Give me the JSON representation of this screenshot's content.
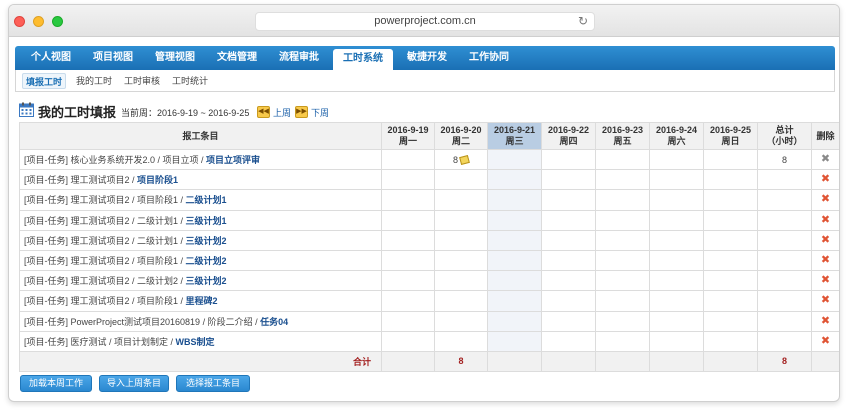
{
  "browser": {
    "url": "powerproject.com.cn"
  },
  "nav": {
    "items": [
      {
        "label": "个人视图"
      },
      {
        "label": "项目视图"
      },
      {
        "label": "管理视图"
      },
      {
        "label": "文档管理"
      },
      {
        "label": "流程审批"
      },
      {
        "label": "工时系统"
      },
      {
        "label": "敏捷开发"
      },
      {
        "label": "工作协同"
      }
    ],
    "active_index": 5
  },
  "subnav": {
    "items": [
      {
        "label": "填报工时"
      },
      {
        "label": "我的工时"
      },
      {
        "label": "工时审核"
      },
      {
        "label": "工时统计"
      }
    ],
    "active_index": 0
  },
  "page": {
    "title": "我的工时填报",
    "week_label": "当前周：2016-9-19 ~ 2016-9-25",
    "prev_label": "上周",
    "next_label": "下周",
    "prev_icon": "double-left-arrow-icon",
    "next_icon": "double-right-arrow-icon"
  },
  "table": {
    "item_header": "报工条目",
    "days": [
      {
        "date": "2016-9-19",
        "weekday": "周一"
      },
      {
        "date": "2016-9-20",
        "weekday": "周二"
      },
      {
        "date": "2016-9-21",
        "weekday": "周三"
      },
      {
        "date": "2016-9-22",
        "weekday": "周四"
      },
      {
        "date": "2016-9-23",
        "weekday": "周五"
      },
      {
        "date": "2016-9-24",
        "weekday": "周六"
      },
      {
        "date": "2016-9-25",
        "weekday": "周日"
      }
    ],
    "today_index": 2,
    "total_header_1": "总计",
    "total_header_2": "（小时）",
    "delete_header": "删除",
    "rows": [
      {
        "prefix": "[项目-任务] 核心业务系统开发2.0 / 项目立项 / ",
        "link": "项目立项评审",
        "hours": [
          "",
          "8",
          "",
          "",
          "",
          "",
          ""
        ],
        "total": "8",
        "deletable": false
      },
      {
        "prefix": "[项目-任务] 理工测试项目2 / ",
        "link": "项目阶段1",
        "hours": [
          "",
          "",
          "",
          "",
          "",
          "",
          ""
        ],
        "total": "",
        "deletable": true
      },
      {
        "prefix": "[项目-任务] 理工测试项目2 / 项目阶段1 / ",
        "link": "二级计划1",
        "hours": [
          "",
          "",
          "",
          "",
          "",
          "",
          ""
        ],
        "total": "",
        "deletable": true
      },
      {
        "prefix": "[项目-任务] 理工测试项目2 / 二级计划1 / ",
        "link": "三级计划1",
        "hours": [
          "",
          "",
          "",
          "",
          "",
          "",
          ""
        ],
        "total": "",
        "deletable": true
      },
      {
        "prefix": "[项目-任务] 理工测试项目2 / 二级计划1 / ",
        "link": "三级计划2",
        "hours": [
          "",
          "",
          "",
          "",
          "",
          "",
          ""
        ],
        "total": "",
        "deletable": true
      },
      {
        "prefix": "[项目-任务] 理工测试项目2 / 项目阶段1 / ",
        "link": "二级计划2",
        "hours": [
          "",
          "",
          "",
          "",
          "",
          "",
          ""
        ],
        "total": "",
        "deletable": true
      },
      {
        "prefix": "[项目-任务] 理工测试项目2 / 二级计划2 / ",
        "link": "三级计划2",
        "hours": [
          "",
          "",
          "",
          "",
          "",
          "",
          ""
        ],
        "total": "",
        "deletable": true
      },
      {
        "prefix": "[项目-任务] 理工测试项目2 / 项目阶段1 / ",
        "link": "里程碑2",
        "hours": [
          "",
          "",
          "",
          "",
          "",
          "",
          ""
        ],
        "total": "",
        "deletable": true
      },
      {
        "prefix": "[项目-任务] PowerProject测试项目20160819 / 阶段二介绍 / ",
        "link": "任务04",
        "hours": [
          "",
          "",
          "",
          "",
          "",
          "",
          ""
        ],
        "total": "",
        "deletable": true
      },
      {
        "prefix": "[项目-任务] 医疗测试 / 项目计划制定 / ",
        "link": "WBS制定",
        "hours": [
          "",
          "",
          "",
          "",
          "",
          "",
          ""
        ],
        "total": "",
        "deletable": true
      }
    ],
    "footer": {
      "label": "合计",
      "hours": [
        "",
        "8",
        "",
        "",
        "",
        "",
        ""
      ],
      "total": "8"
    }
  },
  "buttons": {
    "load_week": "加载本周工作",
    "import_last_week": "导入上周条目",
    "select_items": "选择报工条目"
  },
  "colors": {
    "nav_blue": "#1a6fb4",
    "today_column": "#b9cde3",
    "delete_red": "#e05535",
    "total_red": "#a32020"
  }
}
